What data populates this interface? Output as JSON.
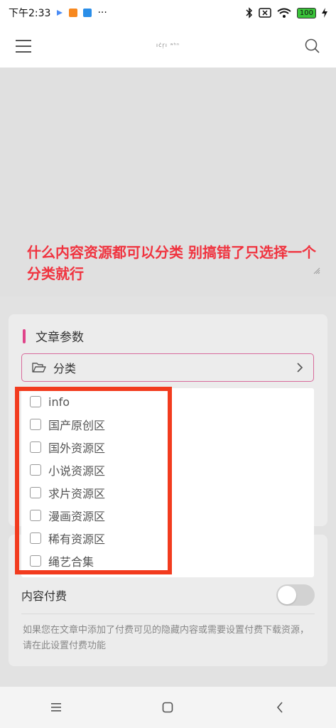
{
  "status_bar": {
    "time": "下午2:33",
    "battery": "100",
    "dots": "···"
  },
  "header": {
    "logo_text": "ıċŗı ʷʰⁿ"
  },
  "annotation": {
    "text": "什么内容资源都可以分类  别搞错了只选择一个分类就行"
  },
  "params_section": {
    "title": "文章参数",
    "category_label": "分类"
  },
  "categories": [
    {
      "label": "info"
    },
    {
      "label": "国产原创区"
    },
    {
      "label": "国外资源区"
    },
    {
      "label": "小说资源区"
    },
    {
      "label": "求片资源区"
    },
    {
      "label": "漫画资源区"
    },
    {
      "label": "稀有资源区"
    },
    {
      "label": "绳艺合集"
    }
  ],
  "pay_section": {
    "label": "内容付费",
    "toggle_on": false,
    "description": "如果您在文章中添加了付费可见的隐藏内容或需要设置付费下载资源，请在此设置付费功能"
  },
  "colors": {
    "accent": "#e0448a",
    "annotation_red": "#f0333f",
    "highlight_red": "#f23b1e"
  }
}
